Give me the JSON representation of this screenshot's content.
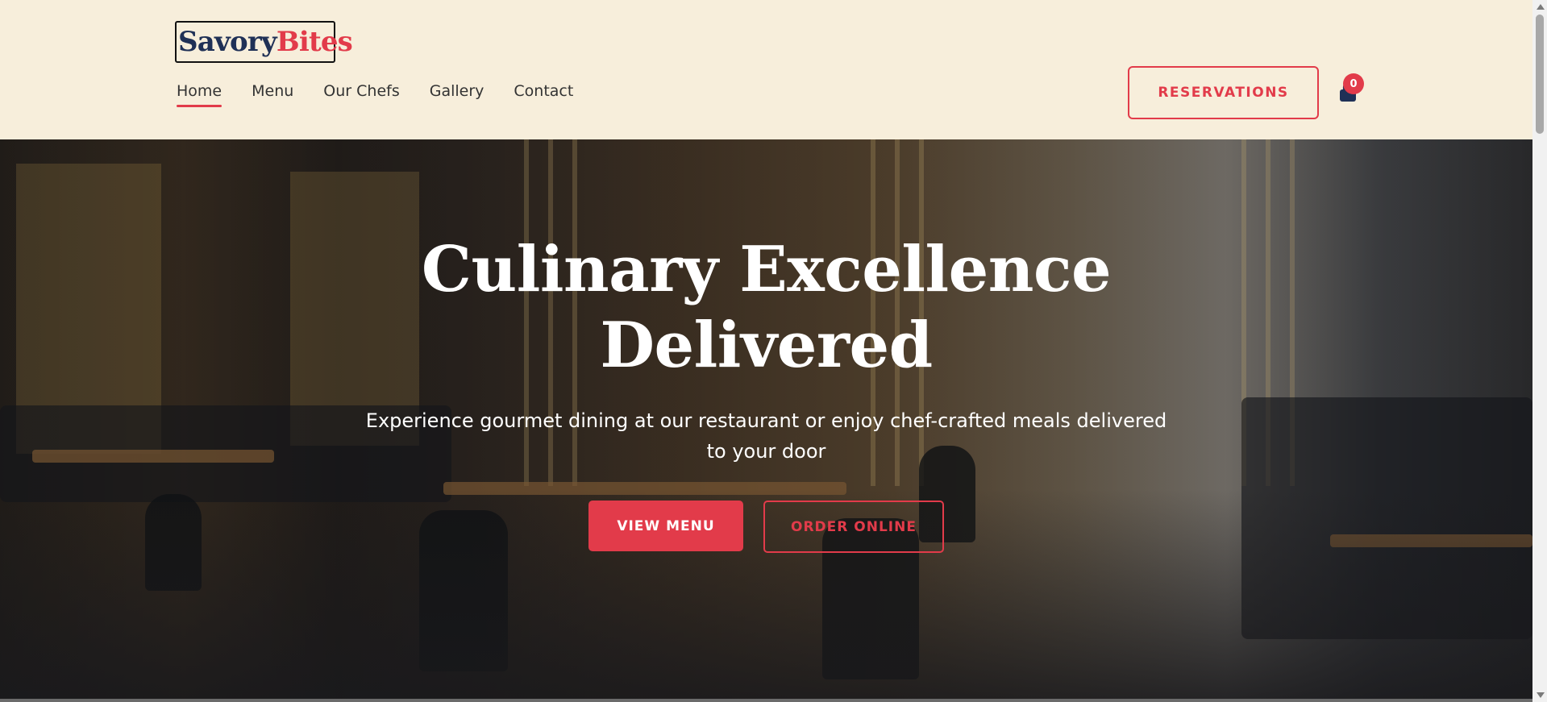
{
  "brand": {
    "part1": "Savory",
    "part2": "Bites"
  },
  "nav": {
    "items": [
      {
        "label": "Home",
        "active": true
      },
      {
        "label": "Menu",
        "active": false
      },
      {
        "label": "Our Chefs",
        "active": false
      },
      {
        "label": "Gallery",
        "active": false
      },
      {
        "label": "Contact",
        "active": false
      }
    ]
  },
  "header": {
    "reservations_label": "RESERVATIONS",
    "cart_icon": "shopping-bag-icon",
    "cart_count": "0"
  },
  "hero": {
    "title_line1": "Culinary Excellence",
    "title_line2": "Delivered",
    "subtitle": "Experience gourmet dining at our restaurant or enjoy chef-crafted meals delivered to your door",
    "primary_button": "VIEW MENU",
    "secondary_button": "ORDER ONLINE"
  },
  "colors": {
    "accent": "#e23b4a",
    "navy": "#1f3056",
    "header_bg": "#f7eedb"
  }
}
